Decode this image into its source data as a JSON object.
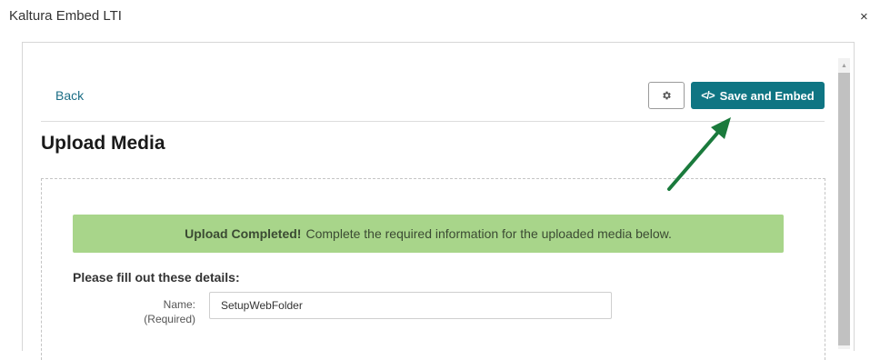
{
  "window": {
    "title": "Kaltura Embed LTI",
    "close_glyph": "×"
  },
  "toolbar": {
    "back_label": "Back",
    "settings_icon": "gear-icon",
    "save_icon": "code-icon",
    "save_icon_glyph": "</>",
    "save_label": "Save and Embed"
  },
  "page": {
    "title": "Upload Media"
  },
  "alert": {
    "strong": "Upload Completed!",
    "message": "Complete the required information for the uploaded media below."
  },
  "form": {
    "heading": "Please fill out these details:",
    "name_label": "Name:",
    "name_required": "(Required)",
    "name_value": "SetupWebFolder"
  },
  "colors": {
    "accent": "#0f7583",
    "link": "#1b6d85",
    "alert_bg": "#a8d58a",
    "annotation_arrow": "#1a7a3c"
  }
}
